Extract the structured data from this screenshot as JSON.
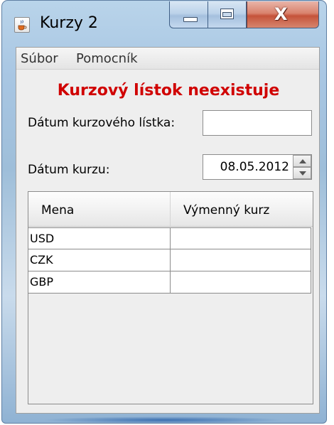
{
  "window": {
    "title": "Kurzy 2",
    "app_icon": "java-cup-icon",
    "controls": {
      "minimize": "minimize-icon",
      "maximize": "maximize-icon",
      "close": "close-icon"
    }
  },
  "menubar": {
    "items": [
      {
        "label": "Súbor"
      },
      {
        "label": "Pomocník"
      }
    ]
  },
  "status": {
    "message": "Kurzový lístok neexistuje",
    "color": "#d00000"
  },
  "form": {
    "exchange_list_date_label": "Dátum kurzového lístka:",
    "exchange_list_date_value": "",
    "rate_date_label": "Dátum kurzu:",
    "rate_date_value": "08.05.2012"
  },
  "table": {
    "columns": [
      "Mena",
      "Výmenný kurz"
    ],
    "rows": [
      [
        "USD",
        ""
      ],
      [
        "CZK",
        ""
      ],
      [
        "GBP",
        ""
      ]
    ]
  }
}
